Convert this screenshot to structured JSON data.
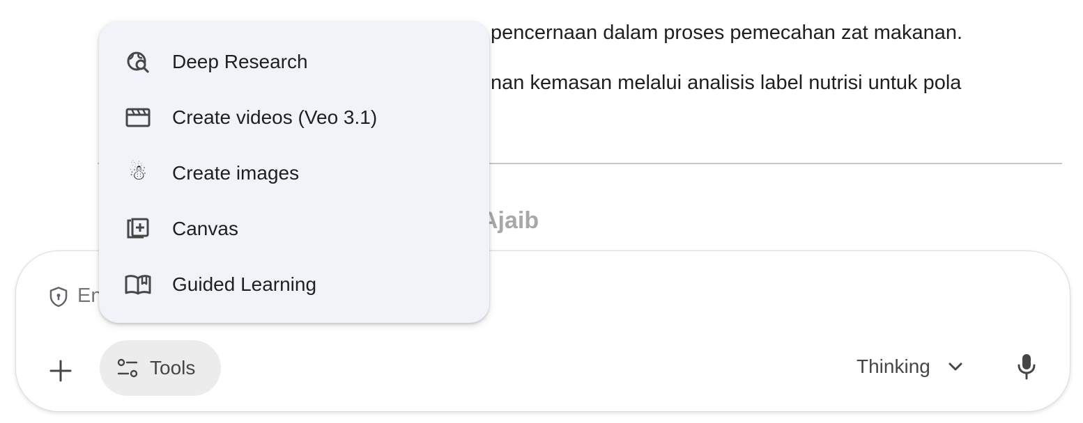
{
  "background": {
    "line1": "pencernaan dalam proses pemecahan zat makanan.",
    "line2": "nan kemasan melalui analisis label nutrisi untuk pola",
    "heading_fragment": "Ajaib"
  },
  "composer": {
    "placeholder_fragment": "En",
    "tools_label": "Tools",
    "model_label": "Thinking"
  },
  "tools_menu": {
    "items": [
      {
        "label": "Deep Research",
        "icon": "deep-research-icon"
      },
      {
        "label": "Create videos (Veo 3.1)",
        "icon": "video-clapper-icon"
      },
      {
        "label": "Create images",
        "icon": "snowman-icon"
      },
      {
        "label": "Canvas",
        "icon": "canvas-add-icon"
      },
      {
        "label": "Guided Learning",
        "icon": "open-book-icon"
      }
    ]
  },
  "colors": {
    "menu_background": "#f0f4f9",
    "tools_button_background": "#ececec",
    "text_primary": "#1f1f1f",
    "text_secondary": "#444746",
    "divider": "#c7c7c7"
  }
}
